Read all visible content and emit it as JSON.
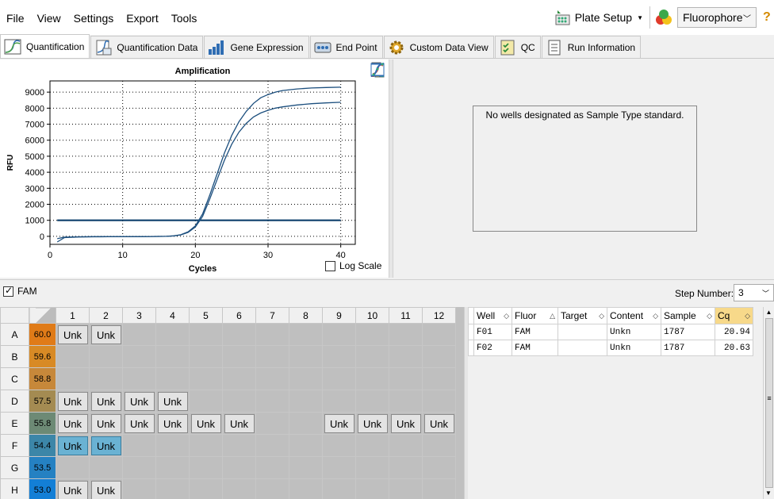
{
  "menu": [
    "File",
    "View",
    "Settings",
    "Export",
    "Tools"
  ],
  "toolbar": {
    "plate_setup": "Plate Setup",
    "fluorophore": "Fluorophore"
  },
  "tabs": [
    {
      "label": "Quantification",
      "active": true,
      "icon": "amplification-icon"
    },
    {
      "label": "Quantification Data",
      "icon": "data-table-icon"
    },
    {
      "label": "Gene Expression",
      "icon": "bar-chart-icon"
    },
    {
      "label": "End Point",
      "icon": "endpoint-icon"
    },
    {
      "label": "Custom Data View",
      "icon": "gear-icon"
    },
    {
      "label": "QC",
      "icon": "checklist-icon"
    },
    {
      "label": "Run Information",
      "icon": "document-icon"
    }
  ],
  "chart_data": {
    "type": "line",
    "title": "Amplification",
    "xlabel": "Cycles",
    "ylabel": "RFU",
    "xlim": [
      0,
      42
    ],
    "ylim": [
      -500,
      9700
    ],
    "xticks": [
      0,
      10,
      20,
      30,
      40
    ],
    "yticks": [
      0,
      1000,
      2000,
      3000,
      4000,
      5000,
      6000,
      7000,
      8000,
      9000
    ],
    "grid": true,
    "threshold": 1000,
    "series": [
      {
        "x": [
          1,
          2,
          4,
          6,
          8,
          10,
          12,
          14,
          16,
          17,
          18,
          19,
          20,
          21,
          22,
          23,
          24,
          25,
          26,
          27,
          28,
          29,
          30,
          31,
          32,
          34,
          36,
          38,
          40
        ],
        "values": [
          -150,
          -50,
          -30,
          -20,
          -20,
          -20,
          -20,
          -10,
          0,
          30,
          100,
          280,
          650,
          1400,
          2600,
          3900,
          5200,
          6300,
          7150,
          7800,
          8300,
          8650,
          8850,
          9000,
          9100,
          9200,
          9260,
          9290,
          9310
        ]
      },
      {
        "x": [
          1,
          2,
          4,
          6,
          8,
          10,
          12,
          14,
          16,
          17,
          18,
          19,
          20,
          21,
          22,
          23,
          24,
          25,
          26,
          27,
          28,
          29,
          30,
          31,
          32,
          34,
          36,
          38,
          40
        ],
        "values": [
          -350,
          -80,
          -40,
          -30,
          -25,
          -20,
          -20,
          -10,
          0,
          25,
          90,
          250,
          580,
          1250,
          2350,
          3550,
          4750,
          5750,
          6500,
          7050,
          7450,
          7700,
          7870,
          8000,
          8080,
          8200,
          8280,
          8330,
          8370
        ]
      }
    ]
  },
  "log_scale_label": "Log Scale",
  "std_message": "No wells designated as Sample Type standard.",
  "fam_label": "FAM",
  "step": {
    "label": "Step Number:",
    "value": "3"
  },
  "plate": {
    "columns": [
      "1",
      "2",
      "3",
      "4",
      "5",
      "6",
      "7",
      "8",
      "9",
      "10",
      "11",
      "12"
    ],
    "rows": [
      {
        "label": "A",
        "temp": "60.0",
        "color": "#e07b18",
        "wells": [
          1,
          2
        ]
      },
      {
        "label": "B",
        "temp": "59.6",
        "color": "#d88a25",
        "wells": []
      },
      {
        "label": "C",
        "temp": "58.8",
        "color": "#c7883a",
        "wells": []
      },
      {
        "label": "D",
        "temp": "57.5",
        "color": "#a48b52",
        "wells": [
          1,
          2,
          3,
          4
        ]
      },
      {
        "label": "E",
        "temp": "55.8",
        "color": "#6d8a75",
        "wells": [
          1,
          2,
          3,
          4,
          5,
          6,
          9,
          10,
          11,
          12
        ]
      },
      {
        "label": "F",
        "temp": "54.4",
        "color": "#3c86a8",
        "wells": [
          1,
          2
        ],
        "selected": [
          1,
          2
        ]
      },
      {
        "label": "G",
        "temp": "53.5",
        "color": "#2581c2",
        "wells": []
      },
      {
        "label": "H",
        "temp": "53.0",
        "color": "#137fd6",
        "wells": [
          1,
          2
        ]
      }
    ],
    "well_label": "Unk"
  },
  "results": {
    "headers": [
      "Well",
      "Fluor",
      "Target",
      "Content",
      "Sample",
      "Cq"
    ],
    "rows": [
      [
        "F01",
        "FAM",
        "",
        "Unkn",
        "1787",
        "20.94"
      ],
      [
        "F02",
        "FAM",
        "",
        "Unkn",
        "1787",
        "20.63"
      ]
    ]
  }
}
